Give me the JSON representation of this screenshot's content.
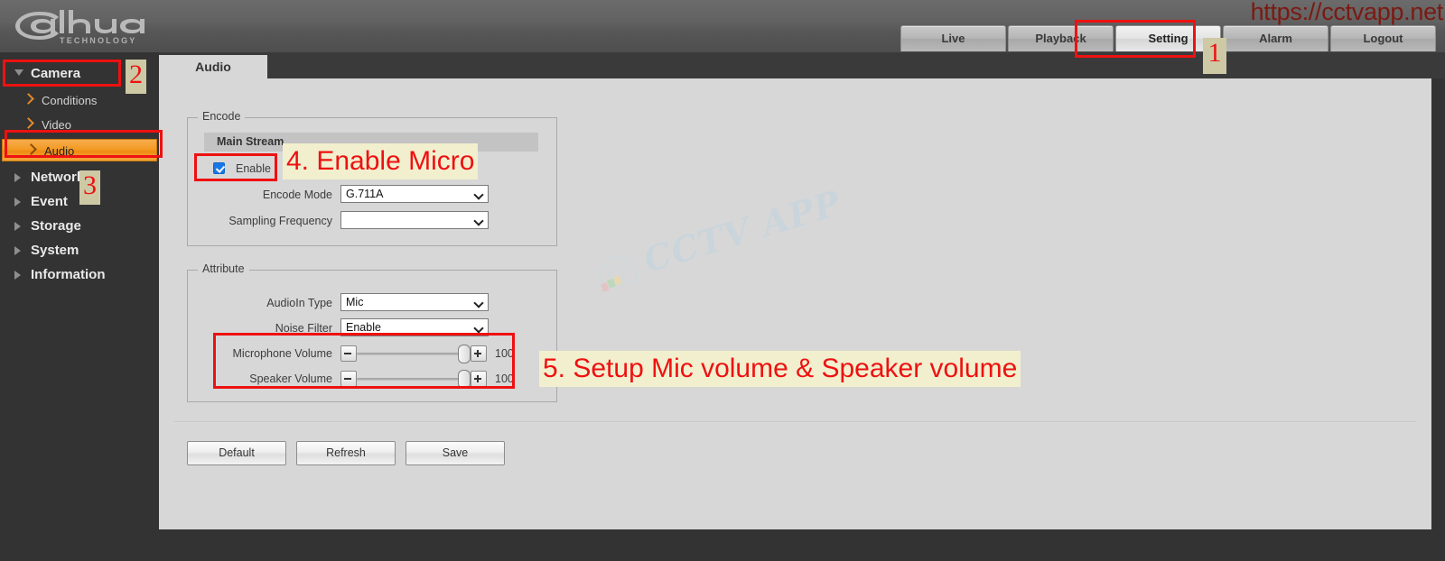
{
  "header": {
    "logo_text": "alhua",
    "logo_sub": "TECHNOLOGY",
    "url": "https://cctvapp.net",
    "nav": [
      {
        "label": "Live",
        "active": false
      },
      {
        "label": "Playback",
        "active": false
      },
      {
        "label": "Setting",
        "active": true
      },
      {
        "label": "Alarm",
        "active": false
      },
      {
        "label": "Logout",
        "active": false
      }
    ]
  },
  "sidebar": {
    "groups": [
      {
        "label": "Camera",
        "expanded": true,
        "selected_child": "Audio",
        "children": [
          {
            "label": "Conditions"
          },
          {
            "label": "Video"
          },
          {
            "label": "Audio"
          }
        ]
      },
      {
        "label": "Network",
        "expanded": false,
        "children": []
      },
      {
        "label": "Event",
        "expanded": false,
        "children": []
      },
      {
        "label": "Storage",
        "expanded": false,
        "children": []
      },
      {
        "label": "System",
        "expanded": false,
        "children": []
      },
      {
        "label": "Information",
        "expanded": false,
        "children": []
      }
    ]
  },
  "content": {
    "tab_label": "Audio",
    "watermark": "CCTV APP",
    "encode": {
      "legend": "Encode",
      "stream_header": "Main Stream",
      "enable_label": "Enable",
      "enable_checked": true,
      "encode_mode_label": "Encode Mode",
      "encode_mode_value": "G.711A",
      "sampling_frequency_label": "Sampling Frequency",
      "sampling_frequency_value": ""
    },
    "attribute": {
      "legend": "Attribute",
      "audioin_type_label": "AudioIn Type",
      "audioin_type_value": "Mic",
      "noise_filter_label": "Noise Filter",
      "noise_filter_value": "Enable",
      "microphone_volume_label": "Microphone Volume",
      "microphone_volume_value": "100",
      "speaker_volume_label": "Speaker Volume",
      "speaker_volume_value": "100"
    },
    "buttons": [
      {
        "label": "Default"
      },
      {
        "label": "Refresh"
      },
      {
        "label": "Save"
      }
    ]
  },
  "annotations": {
    "badge1": "1",
    "badge2": "2",
    "badge3": "3",
    "step4": "4. Enable Micro",
    "step5": "5. Setup Mic volume & Speaker volume"
  },
  "colors": {
    "accent_orange": "#f39c26",
    "annotation_red": "#ee1111",
    "annotation_bg": "#f2efce",
    "badge_bg": "#cdc9a5",
    "panel_bg": "#d7d7d7",
    "chrome_dark": "#333333",
    "url_red": "#7a1a12"
  }
}
